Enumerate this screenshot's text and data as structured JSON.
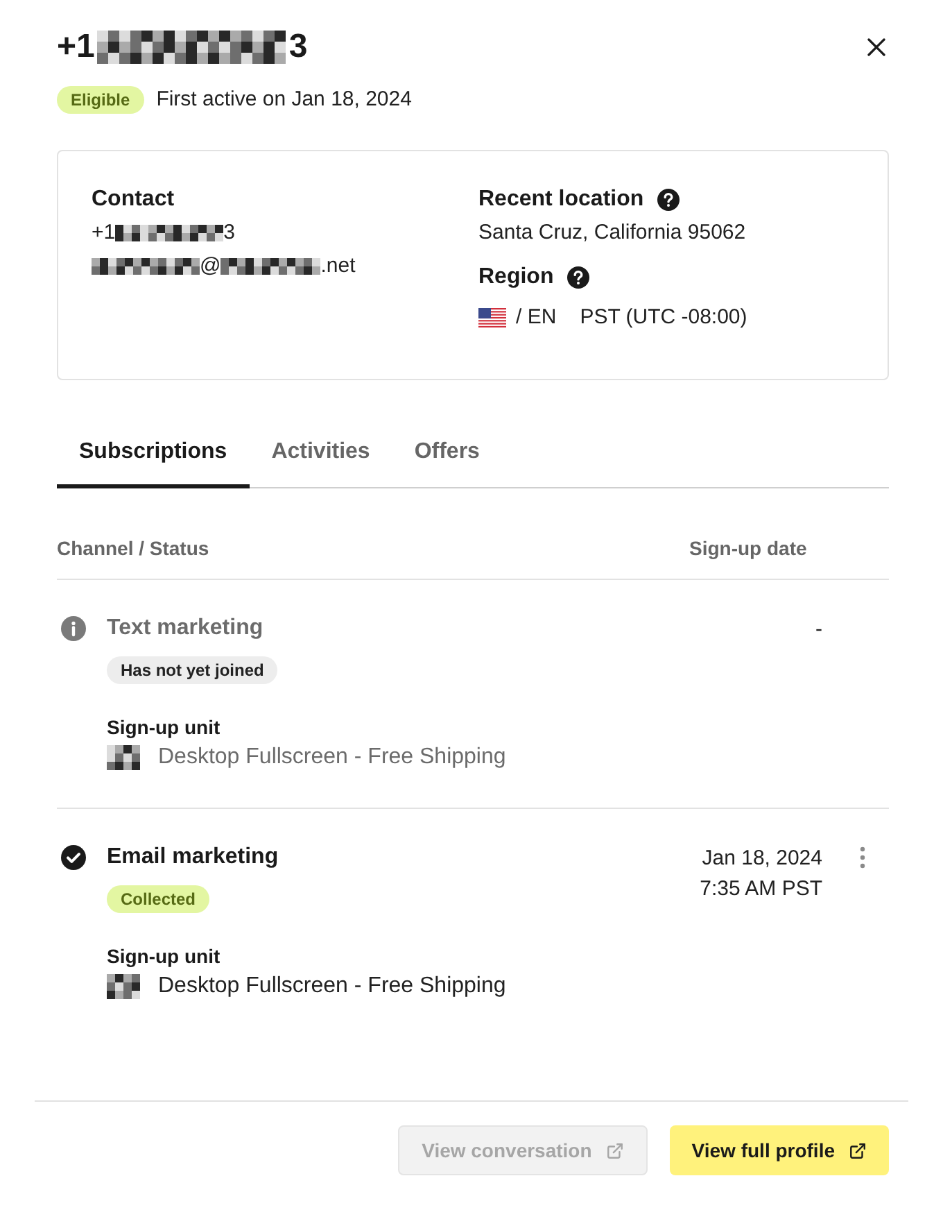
{
  "header": {
    "title_start": "+1",
    "title_end": "3",
    "badge": {
      "label": "Eligible",
      "kind": "success"
    },
    "first_active": "First active on Jan 18, 2024"
  },
  "contact_card": {
    "contact": {
      "label": "Contact",
      "phone_start": "+1",
      "phone_end": "3",
      "email_at": "@",
      "email_end": ".net"
    },
    "recent_location": {
      "label": "Recent location",
      "value": "Santa Cruz, California 95062"
    },
    "region": {
      "label": "Region",
      "language": "/ EN",
      "timezone": "PST (UTC -08:00)"
    }
  },
  "tabs": [
    {
      "label": "Subscriptions",
      "selected": true
    },
    {
      "label": "Activities",
      "selected": false
    },
    {
      "label": "Offers",
      "selected": false
    }
  ],
  "table": {
    "columns": [
      "Channel / Status",
      "Sign-up date"
    ],
    "rows": [
      {
        "channel": "Text marketing",
        "subscribed": false,
        "status": {
          "label": "Has not yet joined",
          "kind": "neutral"
        },
        "unit_label": "Sign-up unit",
        "unit": "Desktop Fullscreen - Free Shipping",
        "signup_date": [
          "-"
        ],
        "menu": false
      },
      {
        "channel": "Email marketing",
        "subscribed": true,
        "status": {
          "label": "Collected",
          "kind": "success"
        },
        "unit_label": "Sign-up unit",
        "unit": "Desktop Fullscreen - Free Shipping",
        "signup_date": [
          "Jan 18, 2024",
          "7:35 AM PST"
        ],
        "menu": true
      }
    ]
  },
  "footer": {
    "buttons": [
      {
        "label": "View conversation",
        "disabled": true
      },
      {
        "label": "View full profile",
        "disabled": false
      }
    ]
  }
}
